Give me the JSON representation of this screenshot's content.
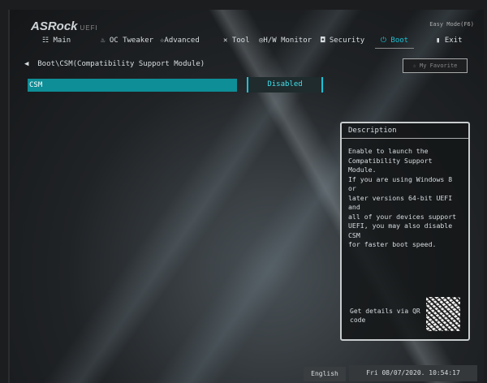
{
  "header": {
    "brand": "ASRock",
    "brand_sub": "UEFI",
    "easy_mode": "Easy Mode(F6)"
  },
  "tabs": [
    {
      "icon": "list-icon",
      "glyph": "☷",
      "label": "Main"
    },
    {
      "icon": "flame-icon",
      "glyph": "♨",
      "label": "OC Tweaker"
    },
    {
      "icon": "star-icon",
      "glyph": "☆",
      "label": "Advanced"
    },
    {
      "icon": "tool-icon",
      "glyph": "✕",
      "label": "Tool"
    },
    {
      "icon": "monitor-icon",
      "glyph": "◎",
      "label": "H/W Monitor"
    },
    {
      "icon": "shield-icon",
      "glyph": "◘",
      "label": "Security"
    },
    {
      "icon": "power-icon",
      "glyph": "⏻",
      "label": "Boot"
    },
    {
      "icon": "exit-icon",
      "glyph": "▮",
      "label": "Exit"
    }
  ],
  "active_tab": "Boot",
  "breadcrumb": "Boot\\CSM(Compatibility Support Module)",
  "favorite": "My Favorite",
  "setting": {
    "label": "CSM",
    "value": "Disabled"
  },
  "description": {
    "title": "Description",
    "text": "Enable to launch the\nCompatibility Support Module.\nIf you are using Windows 8 or\nlater versions 64-bit UEFI and\nall of your devices support\nUEFI, you may also disable CSM\nfor faster boot speed.",
    "qr_text": "Get details via QR code"
  },
  "footer": {
    "language": "English",
    "datetime": "Fri 08/07/2020. 10:54:17"
  }
}
